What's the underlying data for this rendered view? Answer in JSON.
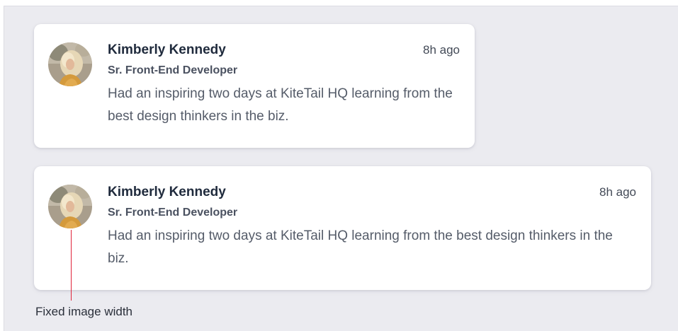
{
  "posts": [
    {
      "author": "Kimberly Kennedy",
      "role": "Sr. Front-End Developer",
      "time": "8h ago",
      "message": "Had an inspiring two days at KiteTail HQ learning from the best design thinkers in the biz.",
      "avatar_icon": "user-photo-avatar"
    },
    {
      "author": "Kimberly Kennedy",
      "role": "Sr. Front-End Developer",
      "time": "8h ago",
      "message": "Had an inspiring two days at KiteTail HQ learning from the best design thinkers in the biz.",
      "avatar_icon": "user-photo-avatar"
    }
  ],
  "annotation": {
    "label": "Fixed image width",
    "color": "#e0243a"
  },
  "colors": {
    "background": "#ebebf0",
    "card": "#ffffff",
    "name_text": "#1f2a3c",
    "body_text": "#555c69"
  }
}
